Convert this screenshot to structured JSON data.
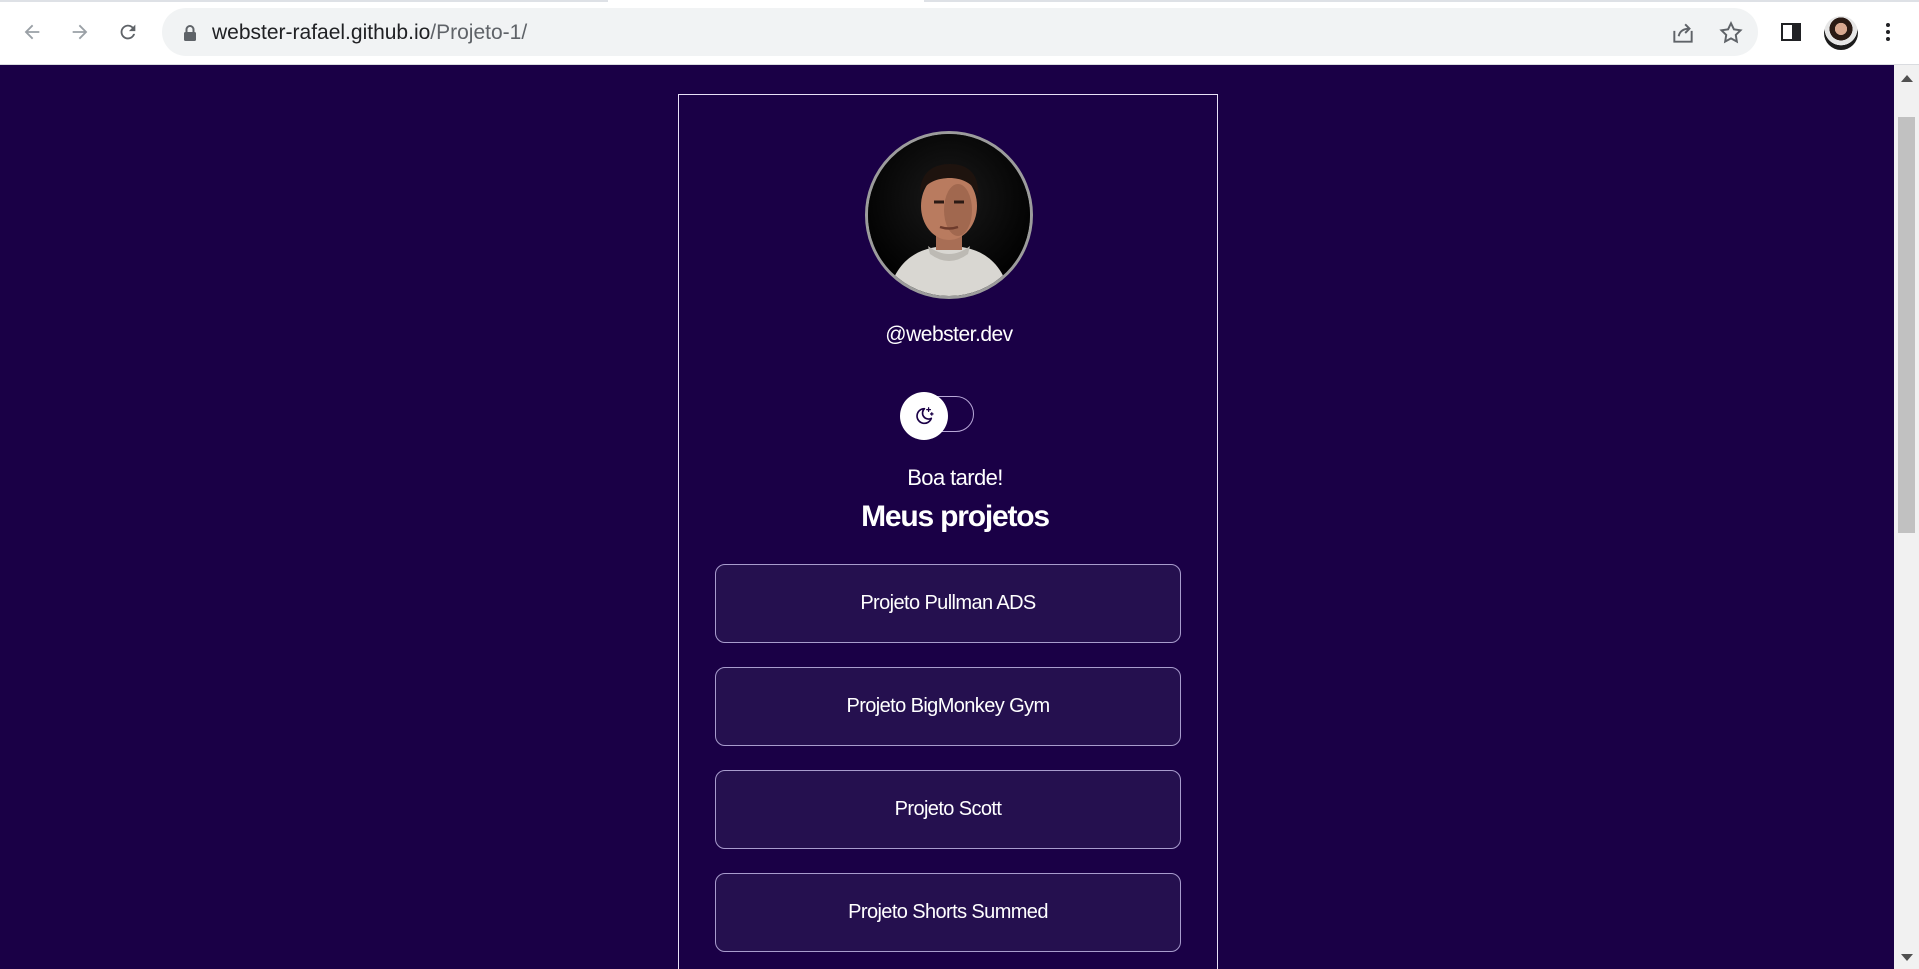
{
  "browser": {
    "url_host": "webster-rafael.github.io",
    "url_path": "/Projeto-1/"
  },
  "profile": {
    "handle": "@webster.dev"
  },
  "theme_toggle": {
    "icon": "moon-stars-icon",
    "state": "dark"
  },
  "greeting": "Boa tarde!",
  "section_title": "Meus projetos",
  "projects": [
    {
      "label": "Projeto Pullman ADS"
    },
    {
      "label": "Projeto BigMonkey Gym"
    },
    {
      "label": "Projeto Scott"
    },
    {
      "label": "Projeto Shorts Summed"
    }
  ],
  "colors": {
    "background": "#1a0046",
    "button_bg": "#25104f",
    "border": "#a89ccd"
  }
}
